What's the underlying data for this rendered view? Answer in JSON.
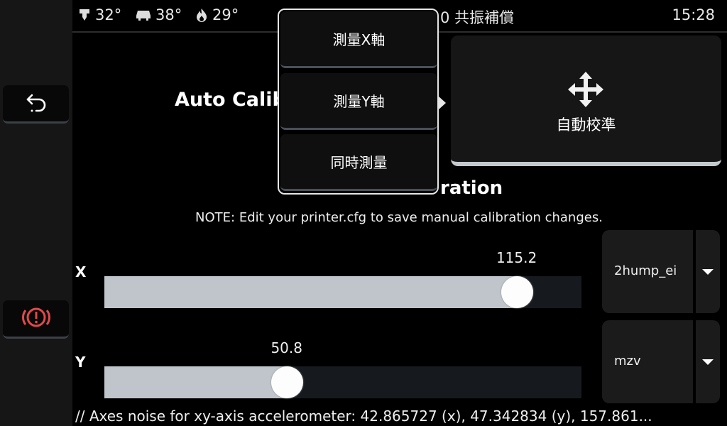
{
  "colors": {
    "accent_emergency": "#e04a4a",
    "slider_fill": "#bfc5cb",
    "panel": "#161616"
  },
  "sidebar": {
    "back_icon": "back-arrow-icon",
    "emergency_icon": "emergency-stop-icon"
  },
  "topbar": {
    "extruder_temp": "32°",
    "bed_temp": "38°",
    "heater_temp": "29°",
    "title": "0 共振補償",
    "time": "15:28"
  },
  "auto_calibration": {
    "heading": "Auto Calib",
    "button_label": "自動校準",
    "button_icon": "move-arrows-icon"
  },
  "popup_menu": {
    "items": [
      "測量X軸",
      "測量Y軸",
      "同時測量"
    ]
  },
  "manual_calibration": {
    "heading": "ration",
    "note": "NOTE: Edit your printer.cfg to save manual calibration changes.",
    "x": {
      "label": "X",
      "value": "115.2",
      "fraction": 0.864,
      "shaper": "2hump_ei"
    },
    "y": {
      "label": "Y",
      "value": "50.8",
      "fraction": 0.382,
      "shaper": "mzv"
    }
  },
  "noise_line": "// Axes noise for xy-axis accelerometer: 42.865727 (x), 47.342834 (y), 157.861..."
}
